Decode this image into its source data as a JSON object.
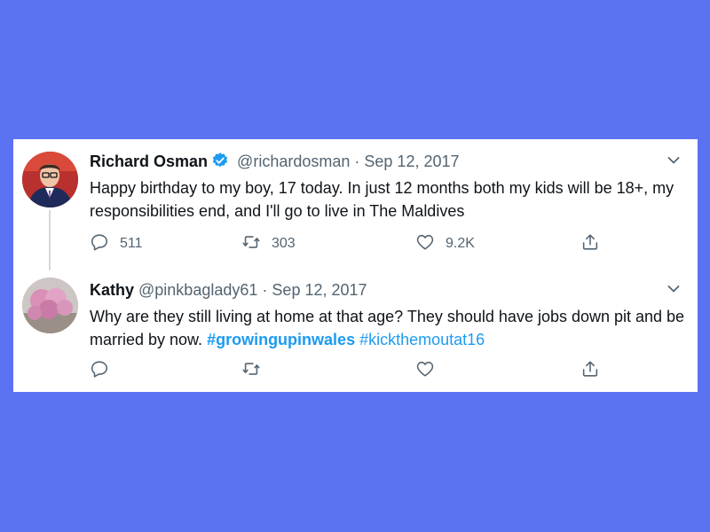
{
  "colors": {
    "background": "#5b72f2",
    "card": "#ffffff",
    "name_text": "#0f1419",
    "meta_text": "#536471",
    "hashtag": "#1d9bf0",
    "verified_badge": "#1d9bf0"
  },
  "tweets": [
    {
      "name": "Richard Osman",
      "verified": true,
      "handle": "@richardosman",
      "separator": "·",
      "date": "Sep 12, 2017",
      "text": "Happy birthday to my boy, 17 today. In just 12 months both my kids will be 18+, my responsibilities end, and I'll go to live in The Maldives",
      "reply_count": "511",
      "retweet_count": "303",
      "like_count": "9.2K",
      "icons": [
        "reply-icon",
        "retweet-icon",
        "like-icon",
        "share-icon",
        "chevron-down-icon",
        "verified-icon"
      ]
    },
    {
      "name": "Kathy",
      "handle": "@pinkbaglady61",
      "separator": "·",
      "date": "Sep 12, 2017",
      "text_plain": "Why are they still living at home at that age? They should have jobs down pit and be married by now. ",
      "hashtag1": "#growingupinwales",
      "hashtag2": "#kickthemoutat16",
      "icons": [
        "reply-icon",
        "retweet-icon",
        "like-icon",
        "share-icon",
        "chevron-down-icon"
      ]
    }
  ]
}
